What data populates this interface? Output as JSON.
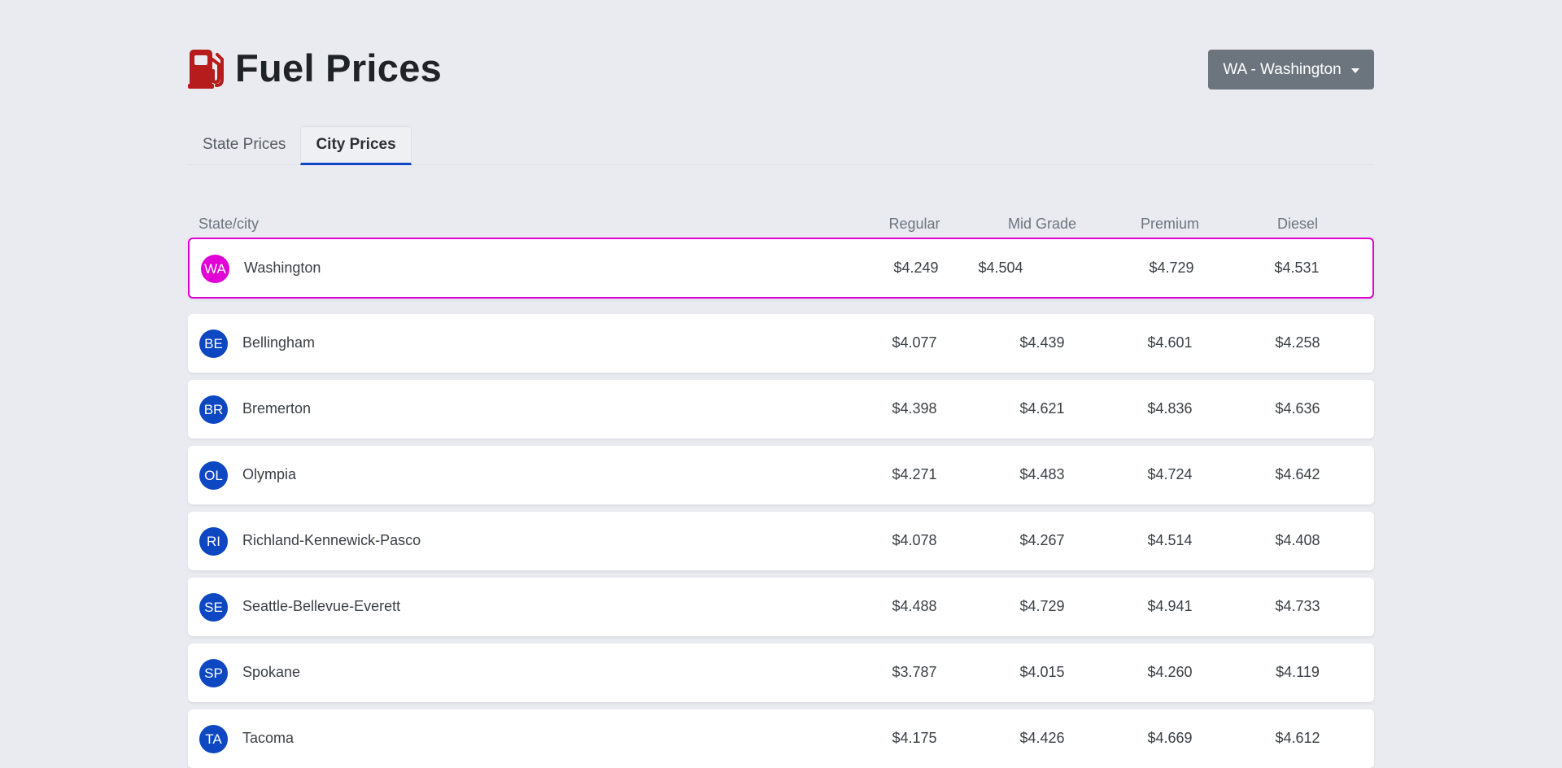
{
  "header": {
    "title": "Fuel Prices",
    "icon": "fuel-pump-icon",
    "icon_color": "#b71c1c",
    "state_dropdown_label": "WA - Washington"
  },
  "tabs": [
    {
      "label": "State Prices",
      "active": false
    },
    {
      "label": "City Prices",
      "active": true
    }
  ],
  "table": {
    "columns": [
      "State/city",
      "Regular",
      "Mid Grade",
      "Premium",
      "Diesel"
    ],
    "state_row": {
      "abbr": "WA",
      "name": "Washington",
      "regular": "$4.249",
      "mid_grade": "$4.504",
      "premium": "$4.729",
      "diesel": "$4.531",
      "accent_color": "#e100d6"
    },
    "city_rows": [
      {
        "abbr": "BE",
        "name": "Bellingham",
        "regular": "$4.077",
        "mid_grade": "$4.439",
        "premium": "$4.601",
        "diesel": "$4.258"
      },
      {
        "abbr": "BR",
        "name": "Bremerton",
        "regular": "$4.398",
        "mid_grade": "$4.621",
        "premium": "$4.836",
        "diesel": "$4.636"
      },
      {
        "abbr": "OL",
        "name": "Olympia",
        "regular": "$4.271",
        "mid_grade": "$4.483",
        "premium": "$4.724",
        "diesel": "$4.642"
      },
      {
        "abbr": "RI",
        "name": "Richland-Kennewick-Pasco",
        "regular": "$4.078",
        "mid_grade": "$4.267",
        "premium": "$4.514",
        "diesel": "$4.408"
      },
      {
        "abbr": "SE",
        "name": "Seattle-Bellevue-Everett",
        "regular": "$4.488",
        "mid_grade": "$4.729",
        "premium": "$4.941",
        "diesel": "$4.733"
      },
      {
        "abbr": "SP",
        "name": "Spokane",
        "regular": "$3.787",
        "mid_grade": "$4.015",
        "premium": "$4.260",
        "diesel": "$4.119"
      },
      {
        "abbr": "TA",
        "name": "Tacoma",
        "regular": "$4.175",
        "mid_grade": "$4.426",
        "premium": "$4.669",
        "diesel": "$4.612"
      }
    ],
    "city_accent_color": "#0d47c1"
  }
}
